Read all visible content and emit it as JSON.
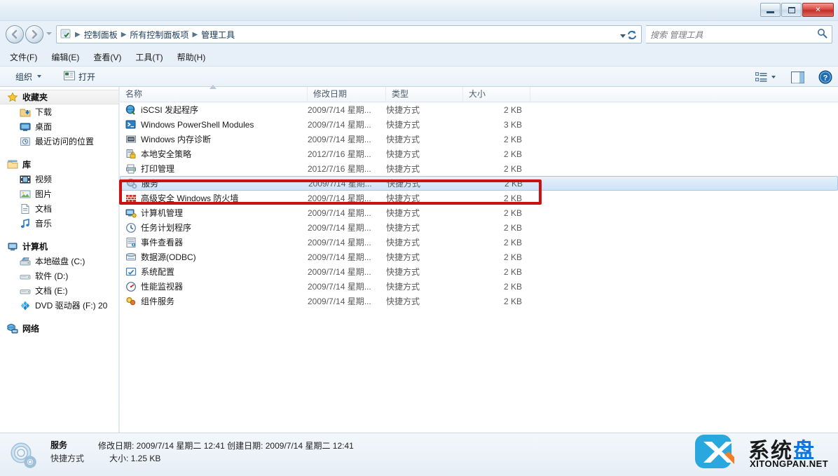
{
  "window": {
    "minimize_label": "最小化",
    "maximize_label": "最大化",
    "close_label": "关闭"
  },
  "address_bar": {
    "back_label": "后退",
    "forward_label": "前进",
    "crumbs": [
      "控制面板",
      "所有控制面板项",
      "管理工具"
    ],
    "separator": "▶",
    "refresh_label": "刷新"
  },
  "search": {
    "placeholder": "搜索 管理工具",
    "icon": "search-icon"
  },
  "menu": {
    "items": [
      "文件(F)",
      "编辑(E)",
      "查看(V)",
      "工具(T)",
      "帮助(H)"
    ]
  },
  "toolbar": {
    "organize_label": "组织",
    "open_label": "打开",
    "view_label": "更改视图",
    "preview_label": "显示预览窗格",
    "help_label": "帮助"
  },
  "sidebar": {
    "groups": [
      {
        "head": "收藏夹",
        "head_icon": "star-icon",
        "selected": true,
        "items": [
          {
            "label": "下载",
            "icon": "download-icon"
          },
          {
            "label": "桌面",
            "icon": "desktop-icon"
          },
          {
            "label": "最近访问的位置",
            "icon": "recent-icon"
          }
        ]
      },
      {
        "head": "库",
        "head_icon": "library-icon",
        "selected": false,
        "items": [
          {
            "label": "视频",
            "icon": "video-icon"
          },
          {
            "label": "图片",
            "icon": "picture-icon"
          },
          {
            "label": "文档",
            "icon": "document-icon"
          },
          {
            "label": "音乐",
            "icon": "music-icon"
          }
        ]
      },
      {
        "head": "计算机",
        "head_icon": "computer-icon",
        "selected": false,
        "items": [
          {
            "label": "本地磁盘 (C:)",
            "icon": "system-drive-icon"
          },
          {
            "label": "软件 (D:)",
            "icon": "drive-icon"
          },
          {
            "label": "文档 (E:)",
            "icon": "drive-icon"
          },
          {
            "label": "DVD 驱动器 (F:) 20",
            "icon": "dvd-drive-icon"
          }
        ]
      },
      {
        "head": "网络",
        "head_icon": "network-icon",
        "selected": false,
        "items": []
      }
    ]
  },
  "file_list": {
    "columns": [
      {
        "label": "名称",
        "key": "name"
      },
      {
        "label": "修改日期",
        "key": "date"
      },
      {
        "label": "类型",
        "key": "type"
      },
      {
        "label": "大小",
        "key": "size"
      }
    ],
    "sort_column": "名称",
    "rows": [
      {
        "name": "iSCSI 发起程序",
        "date": "2009/7/14 星期...",
        "type": "快捷方式",
        "size": "2 KB",
        "icon": "iscsi-icon",
        "selected": false
      },
      {
        "name": "Windows PowerShell Modules",
        "date": "2009/7/14 星期...",
        "type": "快捷方式",
        "size": "3 KB",
        "icon": "powershell-icon",
        "selected": false
      },
      {
        "name": "Windows 内存诊断",
        "date": "2009/7/14 星期...",
        "type": "快捷方式",
        "size": "2 KB",
        "icon": "memory-icon",
        "selected": false
      },
      {
        "name": "本地安全策略",
        "date": "2012/7/16 星期...",
        "type": "快捷方式",
        "size": "2 KB",
        "icon": "security-policy-icon",
        "selected": false
      },
      {
        "name": "打印管理",
        "date": "2012/7/16 星期...",
        "type": "快捷方式",
        "size": "2 KB",
        "icon": "print-management-icon",
        "selected": false
      },
      {
        "name": "服务",
        "date": "2009/7/14 星期...",
        "type": "快捷方式",
        "size": "2 KB",
        "icon": "services-icon",
        "selected": true
      },
      {
        "name": "高级安全 Windows 防火墙",
        "date": "2009/7/14 星期...",
        "type": "快捷方式",
        "size": "2 KB",
        "icon": "firewall-icon",
        "selected": false
      },
      {
        "name": "计算机管理",
        "date": "2009/7/14 星期...",
        "type": "快捷方式",
        "size": "2 KB",
        "icon": "computer-management-icon",
        "selected": false
      },
      {
        "name": "任务计划程序",
        "date": "2009/7/14 星期...",
        "type": "快捷方式",
        "size": "2 KB",
        "icon": "task-scheduler-icon",
        "selected": false
      },
      {
        "name": "事件查看器",
        "date": "2009/7/14 星期...",
        "type": "快捷方式",
        "size": "2 KB",
        "icon": "event-viewer-icon",
        "selected": false
      },
      {
        "name": "数据源(ODBC)",
        "date": "2009/7/14 星期...",
        "type": "快捷方式",
        "size": "2 KB",
        "icon": "odbc-icon",
        "selected": false
      },
      {
        "name": "系统配置",
        "date": "2009/7/14 星期...",
        "type": "快捷方式",
        "size": "2 KB",
        "icon": "msconfig-icon",
        "selected": false
      },
      {
        "name": "性能监视器",
        "date": "2009/7/14 星期...",
        "type": "快捷方式",
        "size": "2 KB",
        "icon": "perfmon-icon",
        "selected": false
      },
      {
        "name": "组件服务",
        "date": "2009/7/14 星期...",
        "type": "快捷方式",
        "size": "2 KB",
        "icon": "component-services-icon",
        "selected": false
      }
    ]
  },
  "details_pane": {
    "title": "服务",
    "dates": "修改日期: 2009/7/14 星期二 12:41 创建日期: 2009/7/14 星期二 12:41",
    "type": "快捷方式",
    "size": "大小: 1.25 KB",
    "icon": "services-icon"
  },
  "annotation": {
    "color": "#cc1111",
    "target": "服务"
  },
  "watermark": {
    "text_dark": "系统",
    "text_blue": "盘",
    "subtitle": "XITONGPAN.NET"
  }
}
